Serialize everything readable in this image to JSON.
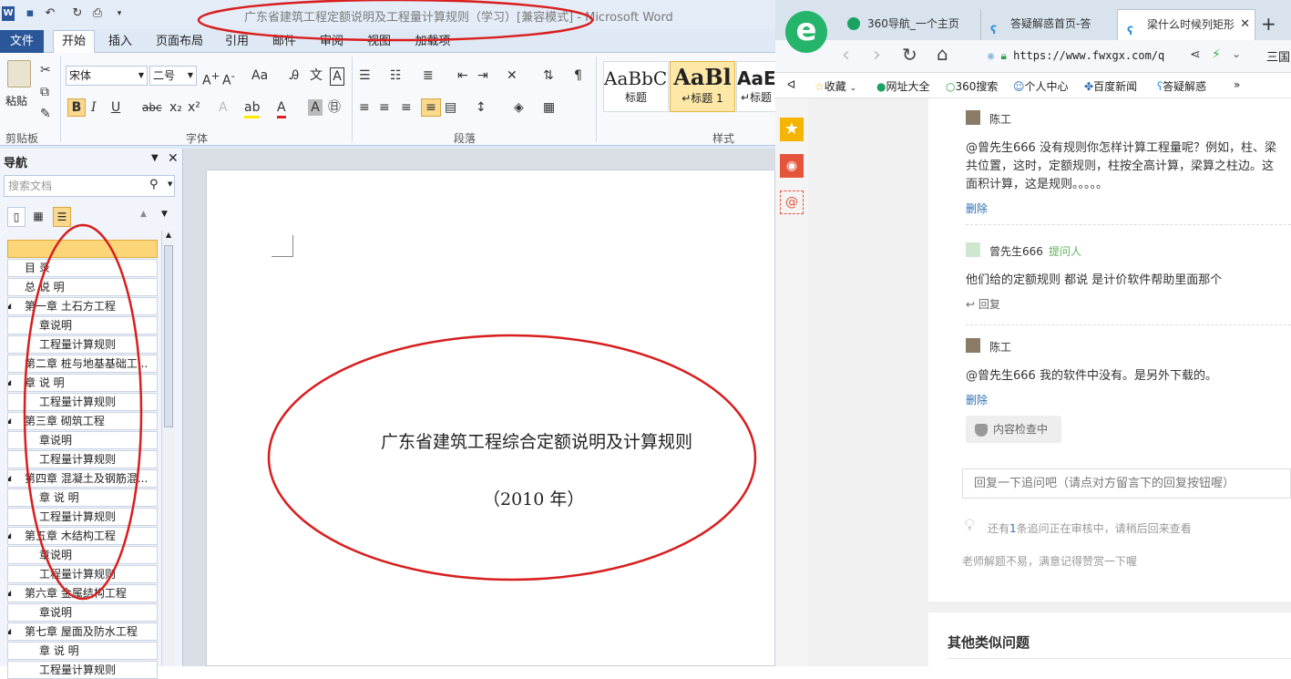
{
  "word": {
    "title": "广东省建筑工程定额说明及工程量计算规则（学习）[兼容模式] - Microsoft Word",
    "menu_tabs": [
      "文件",
      "开始",
      "插入",
      "页面布局",
      "引用",
      "邮件",
      "审阅",
      "视图",
      "加载项"
    ],
    "clipboard": {
      "paste_label": "粘贴",
      "group_label": "剪贴板"
    },
    "font": {
      "name": "宋体",
      "size": "二号",
      "group_label": "字体"
    },
    "paragraph_group_label": "段落",
    "styles": {
      "group_label": "样式",
      "items": [
        {
          "preview": "AaBbC(",
          "label": "标题"
        },
        {
          "preview": "AaBl",
          "label": "↵标题 1"
        },
        {
          "preview": "AaE",
          "label": "↵标题"
        }
      ]
    },
    "nav": {
      "title": "导航",
      "search_placeholder": "搜索文档",
      "items": [
        {
          "label": "",
          "indent": 0,
          "selected": true
        },
        {
          "label": "目  录",
          "indent": 0
        },
        {
          "label": "总 说 明",
          "indent": 0
        },
        {
          "label": "第一章 土石方工程",
          "indent": 0,
          "expander": true
        },
        {
          "label": "章说明",
          "indent": 1
        },
        {
          "label": "工程量计算规则",
          "indent": 1
        },
        {
          "label": "第二章 桩与地基基础工...",
          "indent": 0
        },
        {
          "label": "章    说    明",
          "indent": 0,
          "expander": true
        },
        {
          "label": "工程量计算规则",
          "indent": 1
        },
        {
          "label": "第三章 砌筑工程",
          "indent": 0,
          "expander": true
        },
        {
          "label": "章说明",
          "indent": 1
        },
        {
          "label": "工程量计算规则",
          "indent": 1
        },
        {
          "label": "第四章 混凝土及钢筋混...",
          "indent": 0,
          "expander": true
        },
        {
          "label": "章 说 明",
          "indent": 1
        },
        {
          "label": "工程量计算规则",
          "indent": 1
        },
        {
          "label": "第五章 木结构工程",
          "indent": 0,
          "expander": true
        },
        {
          "label": "章说明",
          "indent": 1
        },
        {
          "label": "工程量计算规则",
          "indent": 1
        },
        {
          "label": "第六章 金属结构工程",
          "indent": 0,
          "expander": true
        },
        {
          "label": "章说明",
          "indent": 1
        },
        {
          "label": "第七章 屋面及防水工程",
          "indent": 0,
          "expander": true
        },
        {
          "label": "章 说 明",
          "indent": 1
        },
        {
          "label": "工程量计算规则",
          "indent": 1
        }
      ]
    },
    "document": {
      "heading": "广东省建筑工程综合定额说明及计算规则",
      "year": "（2010 年）"
    }
  },
  "browser": {
    "tabs": [
      "360导航_一个主页",
      "答疑解惑首页-答",
      "梁什么时候列矩形"
    ],
    "url": "https://www.fwxgx.com/q",
    "menu_label": "三国",
    "favorites": [
      "收藏",
      "网址大全",
      "360搜索",
      "个人中心",
      "百度新闻",
      "答疑解惑"
    ],
    "comments": [
      {
        "user": "陈工",
        "text_lines": [
          "@曾先生666 没有规则你怎样计算工程量呢？例如，柱、梁",
          "共位置，这时，定额规则，柱按全高计算，梁算之柱边。这",
          "面积计算，这是规则。。。。。"
        ],
        "action": "删除"
      },
      {
        "user": "曾先生666",
        "tag": "提问人",
        "text_lines": [
          "他们给的定额规则 都说 是计价软件帮助里面那个"
        ],
        "action": "回复"
      },
      {
        "user": "陈工",
        "text_lines": [
          "@曾先生666 我的软件中没有。是另外下载的。"
        ],
        "action": "删除"
      }
    ],
    "review_badge": "内容检查中",
    "reply_placeholder": "回复一下追问吧（请点对方留言下的回复按钮喔）",
    "pending_prefix": "还有",
    "pending_count": "1",
    "pending_suffix": "条追问正在审核中，请稍后回来查看",
    "thanks_note": "老师解题不易，满意记得赞赏一下喔",
    "similar_heading": "其他类似问题"
  },
  "colors": {
    "word_blue": "#2b579a",
    "annotation_red": "#d81e1e",
    "link_blue": "#2f6fb2",
    "green": "#5fb05f"
  }
}
